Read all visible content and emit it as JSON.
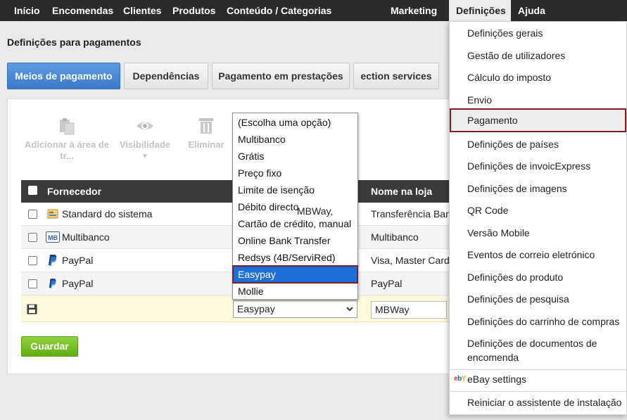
{
  "nav": {
    "items": [
      "Início",
      "Encomendas",
      "Clientes",
      "Produtos",
      "Conteúdo / Categorias",
      "Marketing",
      "Definições",
      "Ajuda"
    ]
  },
  "page_title": "Definições para pagamentos",
  "tabs": [
    "Meios de pagamento",
    "Dependências",
    "Pagamento em prestações",
    "ection services"
  ],
  "toolbar": {
    "add_clipboard": "Adicionar à área de tr...",
    "visibility": "Visibilidade",
    "delete": "Eliminar"
  },
  "table": {
    "headers": {
      "provider": "Fornecedor",
      "store_name": "Nome na loja"
    },
    "rows": [
      {
        "provider": "Standard do sistema",
        "icon": "system-standard-icon",
        "store_name": "Transferência Ban"
      },
      {
        "provider": "Multibanco",
        "icon": "multibanco-icon",
        "store_name": "Multibanco"
      },
      {
        "provider": "PayPal",
        "icon": "paypal-icon",
        "store_name": "Visa, Master Carda"
      },
      {
        "provider": "PayPal",
        "icon": "paypal-icon",
        "store_name": "PayPal"
      }
    ],
    "new_row": {
      "select_value": "Easypay",
      "name_value": "MBWay"
    }
  },
  "dropdown": {
    "options": [
      "(Escolha uma opção)",
      "Multibanco",
      "Grátis",
      "Preço fixo",
      "Limite de isenção",
      "Débito directo",
      "Cartão de crédito, manual",
      "Online Bank Transfer",
      "Redsys (4B/ServiRed)",
      "Easypay",
      "Mollie"
    ],
    "selected": "Easypay",
    "overflow_text": "MBWay,"
  },
  "save_label": "Guardar",
  "settings_menu": {
    "items": [
      "Definições gerais",
      "Gestão de utilizadores",
      "Cálculo do imposto",
      "Envio",
      "Pagamento",
      "Definições de países",
      "Definições de invoicExpress",
      "Definições de imagens",
      "QR Code",
      "Versão Mobile",
      "Eventos de correio eletrónico",
      "Definições do produto",
      "Definições de pesquisa",
      "Definições do carrinho de compras",
      "Definições de documentos de encomenda",
      "eBay settings",
      "Reiniciar o assistente de instalação"
    ],
    "highlighted": "Pagamento",
    "ebay_logo": "ebY"
  },
  "colors": {
    "nav_bg": "#2b2b2b",
    "tab_active": "#3b78c9",
    "highlight_outline": "#7a1d24",
    "save_green": "#6cbf1e",
    "selected_option": "#1e70d8"
  }
}
